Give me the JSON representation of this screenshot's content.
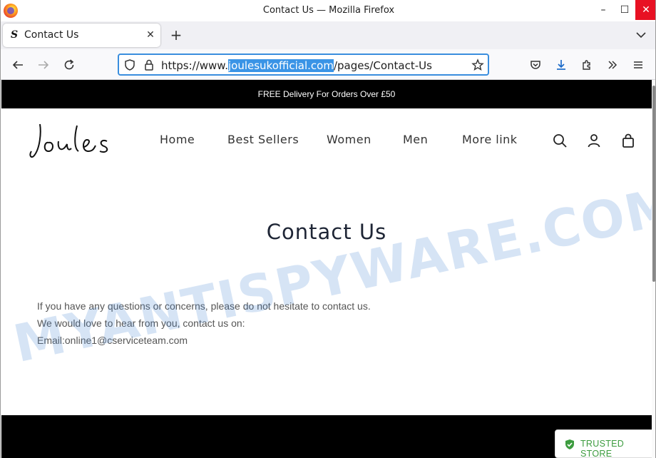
{
  "window": {
    "title": "Contact Us — Mozilla Firefox",
    "buttons": {
      "minimize": "–",
      "maximize": "☐",
      "close": "✕"
    }
  },
  "tabs": [
    {
      "title": "Contact Us",
      "favicon": "S"
    }
  ],
  "tabstrip": {
    "new_tab": "+"
  },
  "urlbar": {
    "prefix": "https://www.",
    "domain": "joulesukofficial.com",
    "path": "/pages/Contact-Us"
  },
  "site": {
    "promo": "FREE Delivery For Orders Over £50",
    "logo_text": "Joules",
    "nav": [
      "Home",
      "Best Sellers",
      "Women",
      "Men",
      "More link"
    ]
  },
  "content": {
    "title": "Contact Us",
    "lines": [
      "If you have any questions or concerns, please do not hesitate to contact us.",
      "We would love to hear from you, contact us on:",
      "Email:online1@cserviceteam.com"
    ]
  },
  "badge": {
    "label": "TRUSTED STORE"
  },
  "watermark": "MYANTISPYWARE.COM",
  "colors": {
    "accent": "#3a8ede",
    "url_highlight": "#3a94e6",
    "promo_bg": "#000000",
    "trusted_green": "#3d9c3f",
    "close_red": "#e81123"
  }
}
